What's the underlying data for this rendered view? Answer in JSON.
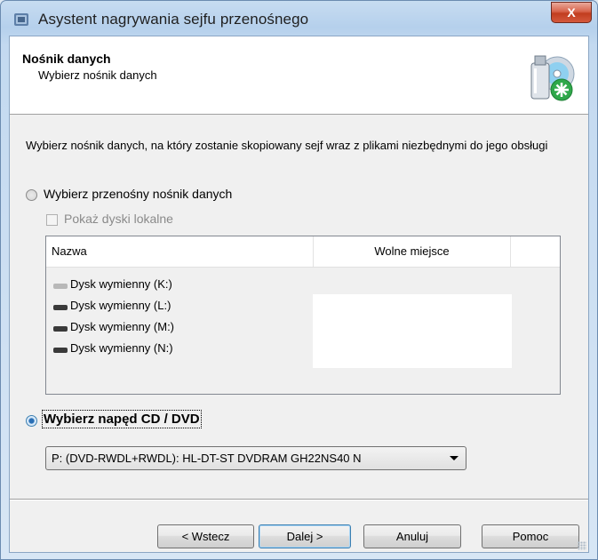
{
  "window": {
    "title": "Asystent nagrywania sejfu przenośnego",
    "close_label": "X"
  },
  "header": {
    "title": "Nośnik danych",
    "subtitle": "Wybierz nośnik danych"
  },
  "description": "Wybierz nośnik danych, na który zostanie skopiowany sejf wraz z plikami niezbędnymi do jego obsługi",
  "options": {
    "portable_label": "Wybierz przenośny nośnik danych",
    "show_local_label": "Pokaż dyski lokalne",
    "cd_dvd_label": "Wybierz napęd CD / DVD"
  },
  "table": {
    "columns": [
      "Nazwa",
      "Wolne miejsce"
    ],
    "rows": [
      {
        "name": "Dysk wymienny (K:)",
        "free": ""
      },
      {
        "name": "Dysk wymienny (L:)",
        "free": ""
      },
      {
        "name": "Dysk wymienny (M:)",
        "free": ""
      },
      {
        "name": "Dysk wymienny (N:)",
        "free": ""
      }
    ]
  },
  "drive_select": {
    "value": "P: (DVD-RWDL+RWDL):  HL-DT-ST DVDRAM GH22NS40 N"
  },
  "buttons": {
    "back": "< Wstecz",
    "next": "Dalej >",
    "cancel": "Anuluj",
    "help": "Pomoc"
  },
  "colors": {
    "accent": "#3c7fb1",
    "close": "#c13d1f"
  }
}
